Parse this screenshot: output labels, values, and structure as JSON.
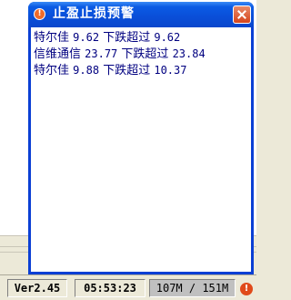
{
  "window": {
    "title": "止盈止损预警",
    "alerts": [
      {
        "name": "特尔佳",
        "price": "9.62",
        "condition": "下跌超过",
        "threshold": "9.62"
      },
      {
        "name": "信维通信",
        "price": "23.77",
        "condition": "下跌超过",
        "threshold": "23.84"
      },
      {
        "name": "特尔佳",
        "price": "9.88",
        "condition": "下跌超过",
        "threshold": "10.37"
      }
    ]
  },
  "statusbar": {
    "version": "Ver2.45",
    "time": "05:53:23",
    "memory": "107M / 151M"
  },
  "icons": {
    "title": "alert-icon",
    "close": "close-icon",
    "status_alert": "alert-icon"
  }
}
